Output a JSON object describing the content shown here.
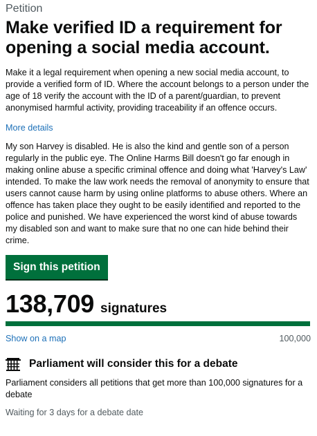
{
  "petition": {
    "caption": "Petition",
    "title": "Make verified ID a requirement for opening a social media account.",
    "summary": "Make it a legal requirement when opening a new social media account, to provide a verified form of ID. Where the account belongs to a person under the age of 18 verify the account with the ID of a parent/guardian, to prevent anonymised harmful activity, providing traceability if an offence occurs.",
    "more_details_label": "More details",
    "details": "My son Harvey is disabled. He is also the kind and gentle son of a person regularly in the public eye. The Online Harms Bill doesn't go far enough in making online abuse a specific criminal offence and doing what 'Harvey's Law' intended. To make the law work needs the removal of anonymity to ensure that users cannot cause harm by using online platforms to abuse others. Where an offence has taken place they ought to be easily identified and reported to the police and punished. We have experienced the worst kind of abuse towards my disabled son and want to make sure that no one can hide behind their crime.",
    "sign_button_label": "Sign this petition"
  },
  "signatures": {
    "count": "138,709",
    "label": "signatures",
    "progress_fraction": 1.0,
    "map_link_label": "Show on a map",
    "threshold": "100,000"
  },
  "debate": {
    "icon": "portcullis-icon",
    "title": "Parliament will consider this for a debate",
    "text": "Parliament considers all petitions that get more than 100,000 signatures for a debate",
    "status": "Waiting for 3 days for a debate date"
  },
  "colors": {
    "button": "#00703c",
    "progress": "#00703c",
    "link": "#1d70b8"
  }
}
